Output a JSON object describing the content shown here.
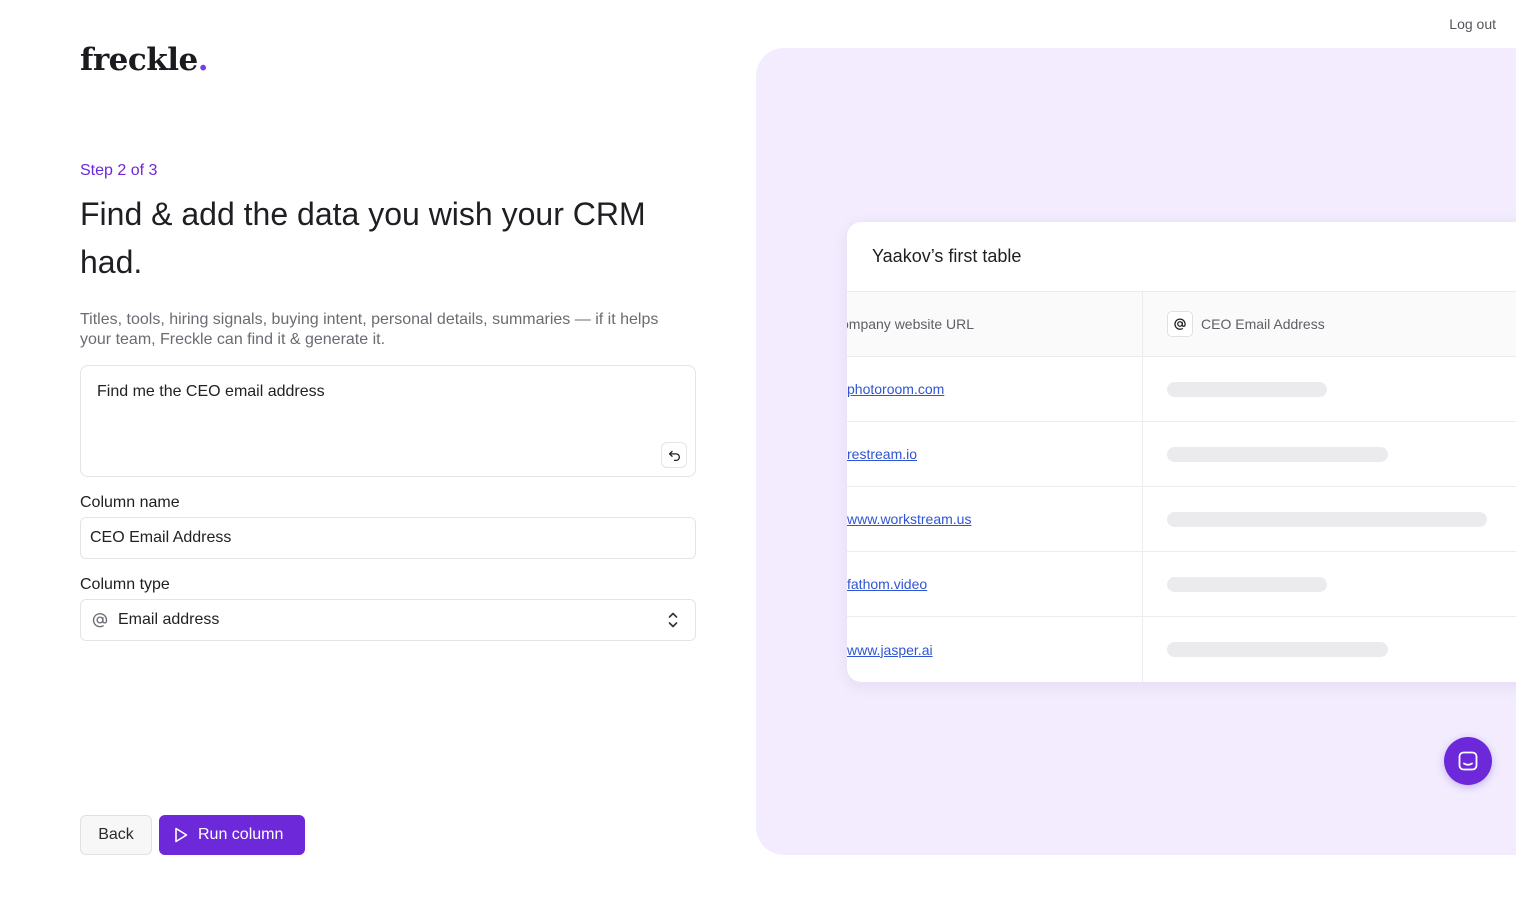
{
  "header": {
    "logout_label": "Log out"
  },
  "brand": {
    "name": "freckle",
    "dot": ".",
    "accent": "#7c3aed"
  },
  "wizard": {
    "step": "Step 2 of 3",
    "headline": "Find & add the data you wish your CRM had.",
    "subtext": "Titles, tools, hiring signals, buying intent, personal details, summaries — if it helps your team, Freckle can find it & generate it.",
    "prompt": "Find me the CEO email address",
    "undo_icon": "undo-icon"
  },
  "form": {
    "column_name_label": "Column name",
    "column_name_value": "CEO Email Address",
    "column_type_label": "Column type",
    "column_type_value": "Email address",
    "column_type_icon": "at-sign-icon"
  },
  "actions": {
    "back_label": "Back",
    "run_label": "Run column",
    "primary_color": "#6d28d9"
  },
  "preview": {
    "table_title": "Yaakov’s first table",
    "columns": [
      "ompany website URL",
      "CEO Email Address"
    ],
    "rows": [
      {
        "url": "photoroom.com",
        "loading_fraction": 0.5
      },
      {
        "url": "restream.io",
        "loading_fraction": 0.69
      },
      {
        "url": "www.workstream.us",
        "loading_fraction": 1.0
      },
      {
        "url": "fathom.video",
        "loading_fraction": 0.5
      },
      {
        "url": "www.jasper.ai",
        "loading_fraction": 0.69
      }
    ],
    "background": "#f2ecfe"
  },
  "support": {
    "icon": "chat-icon"
  }
}
